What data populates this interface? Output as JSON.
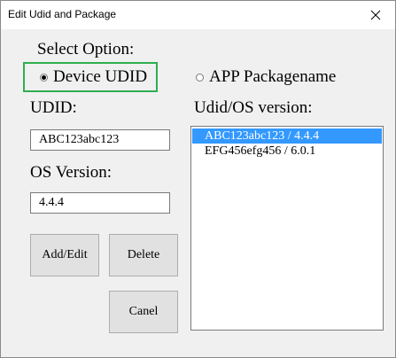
{
  "window": {
    "title": "Edit Udid and Package"
  },
  "options": {
    "heading": "Select Option:",
    "items": [
      {
        "label": "Device UDID",
        "checked": true
      },
      {
        "label": "APP Packagename",
        "checked": false
      }
    ],
    "highlight_color": "#2fae4f"
  },
  "udid": {
    "label": "UDID:",
    "value": "ABC123abc123"
  },
  "os_version": {
    "label": "OS Version:",
    "value": "4.4.4"
  },
  "list": {
    "label": "Udid/OS version:",
    "items": [
      {
        "text": "ABC123abc123 / 4.4.4",
        "selected": true
      },
      {
        "text": "EFG456efg456 / 6.0.1",
        "selected": false
      }
    ],
    "selection_color": "#3399ff"
  },
  "buttons": {
    "add_edit": "Add/Edit",
    "delete": "Delete",
    "cancel": "Canel"
  },
  "icons": {
    "close": "close-icon",
    "radio": "radio-icon"
  }
}
